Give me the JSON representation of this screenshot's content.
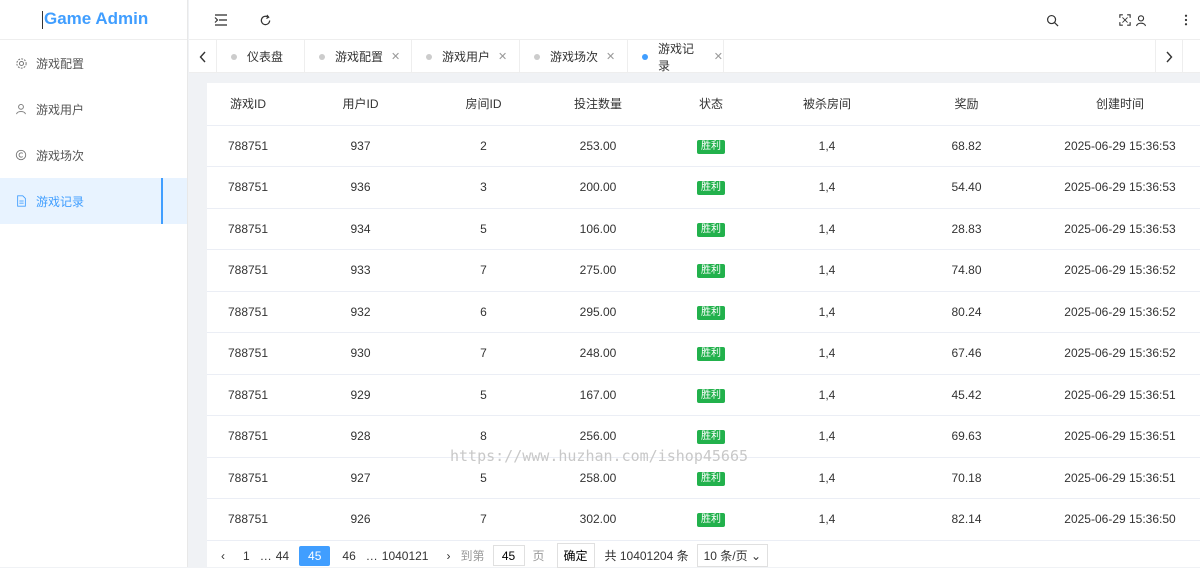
{
  "app": {
    "title": "Game Admin"
  },
  "sidebar": {
    "items": [
      {
        "label": "游戏配置",
        "icon": "gear-icon"
      },
      {
        "label": "游戏用户",
        "icon": "user-icon"
      },
      {
        "label": "游戏场次",
        "icon": "copyright-icon"
      },
      {
        "label": "游戏记录",
        "icon": "document-icon",
        "active": true
      }
    ]
  },
  "tabs": [
    {
      "label": "仪表盘"
    },
    {
      "label": "游戏配置",
      "close": "✕"
    },
    {
      "label": "游戏用户",
      "close": "✕"
    },
    {
      "label": "游戏场次",
      "close": "✕"
    },
    {
      "label": "游戏记录",
      "close": "✕",
      "active": true
    }
  ],
  "table": {
    "headers": [
      "游戏ID",
      "用户ID",
      "房间ID",
      "投注数量",
      "状态",
      "被杀房间",
      "奖励",
      "创建时间"
    ],
    "rows": [
      [
        "788751",
        "937",
        "2",
        "253.00",
        "胜利",
        "1,4",
        "68.82",
        "2025-06-29 15:36:53"
      ],
      [
        "788751",
        "936",
        "3",
        "200.00",
        "胜利",
        "1,4",
        "54.40",
        "2025-06-29 15:36:53"
      ],
      [
        "788751",
        "934",
        "5",
        "106.00",
        "胜利",
        "1,4",
        "28.83",
        "2025-06-29 15:36:53"
      ],
      [
        "788751",
        "933",
        "7",
        "275.00",
        "胜利",
        "1,4",
        "74.80",
        "2025-06-29 15:36:52"
      ],
      [
        "788751",
        "932",
        "6",
        "295.00",
        "胜利",
        "1,4",
        "80.24",
        "2025-06-29 15:36:52"
      ],
      [
        "788751",
        "930",
        "7",
        "248.00",
        "胜利",
        "1,4",
        "67.46",
        "2025-06-29 15:36:52"
      ],
      [
        "788751",
        "929",
        "5",
        "167.00",
        "胜利",
        "1,4",
        "45.42",
        "2025-06-29 15:36:51"
      ],
      [
        "788751",
        "928",
        "8",
        "256.00",
        "胜利",
        "1,4",
        "69.63",
        "2025-06-29 15:36:51"
      ],
      [
        "788751",
        "927",
        "5",
        "258.00",
        "胜利",
        "1,4",
        "70.18",
        "2025-06-29 15:36:51"
      ],
      [
        "788751",
        "926",
        "7",
        "302.00",
        "胜利",
        "1,4",
        "82.14",
        "2025-06-29 15:36:50"
      ]
    ]
  },
  "pager": {
    "prev": "‹",
    "pages": [
      "1",
      "…",
      "44",
      "45",
      "46",
      "…",
      "1040121"
    ],
    "current": "45",
    "next": "›",
    "goto_label": "到第",
    "goto_value": "45",
    "page_unit": "页",
    "confirm": "确定",
    "total": "共 10401204 条",
    "page_size": "10 条/页"
  },
  "watermark": "https://www.huzhan.com/ishop45665",
  "colors": {
    "accent": "#409eff",
    "success": "#22b14c"
  }
}
